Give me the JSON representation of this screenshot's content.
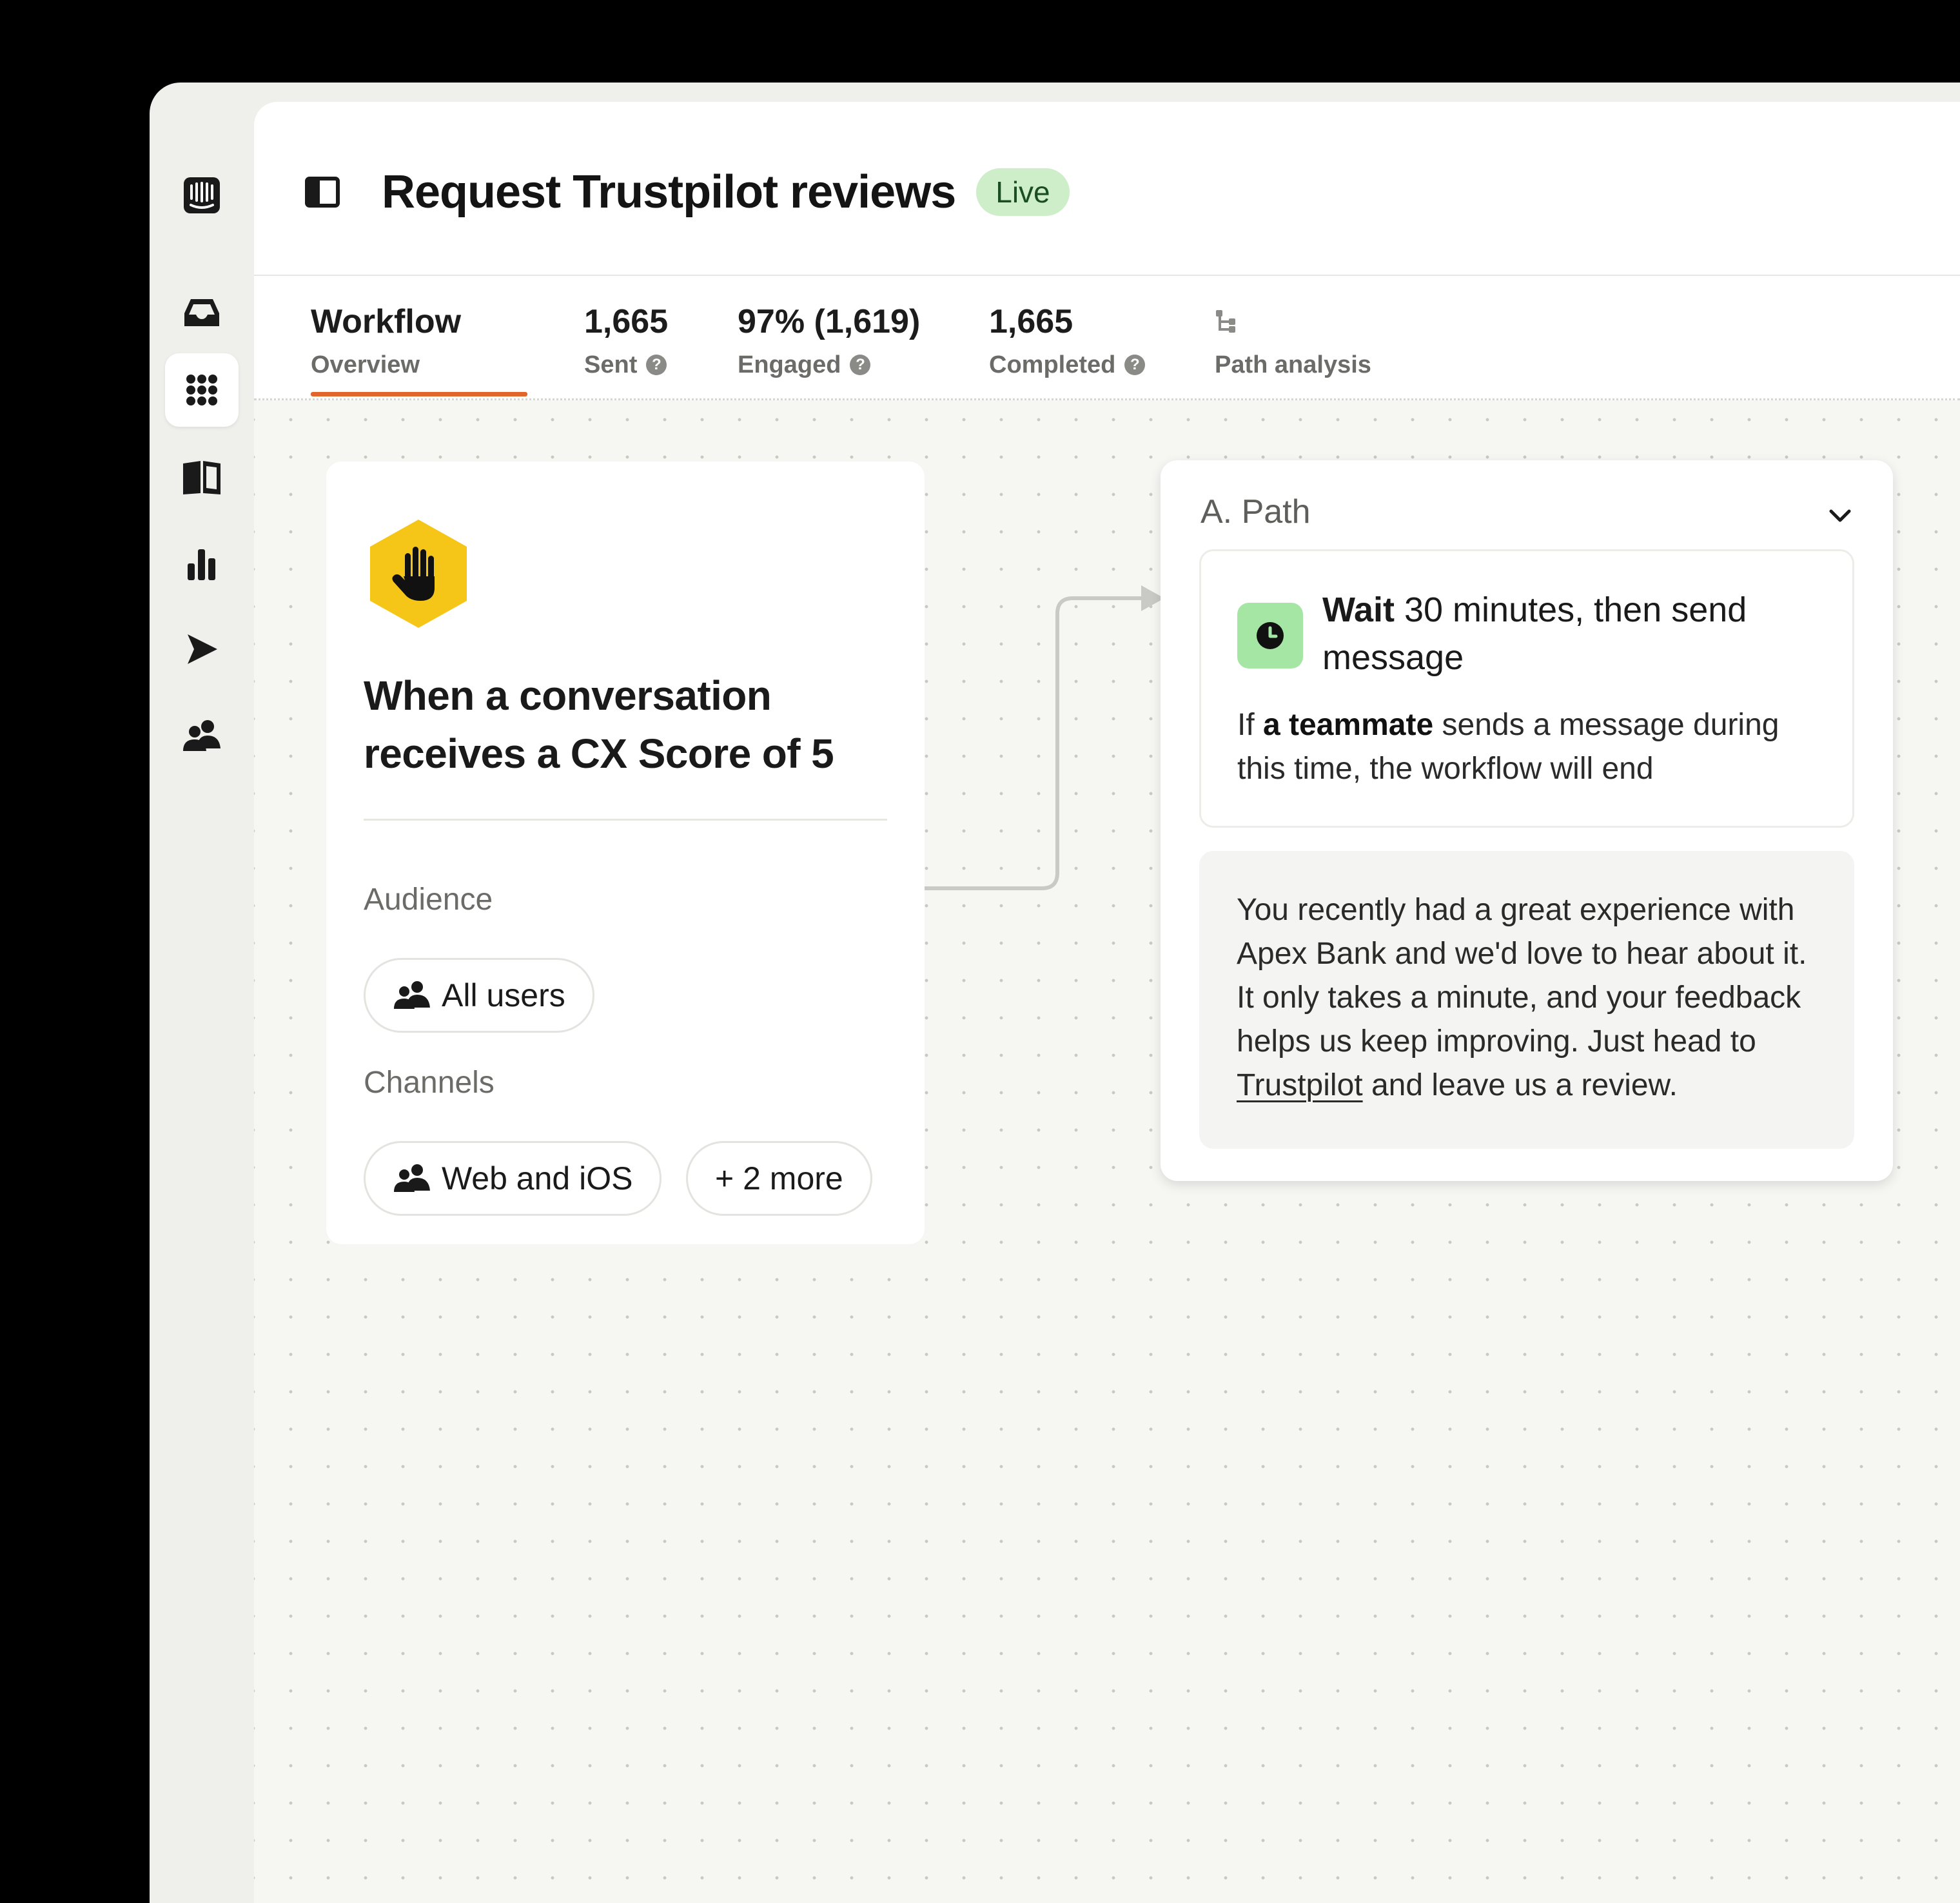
{
  "header": {
    "title": "Request Trustpilot reviews",
    "status": "Live"
  },
  "stats": [
    {
      "value": "Workflow",
      "label": "Overview",
      "help": false
    },
    {
      "value": "1,665",
      "label": "Sent",
      "help": true
    },
    {
      "value": "97% (1,619)",
      "label": "Engaged",
      "help": true
    },
    {
      "value": "1,665",
      "label": "Completed",
      "help": true
    },
    {
      "value": "",
      "label": "Path analysis",
      "help": false
    }
  ],
  "trigger": {
    "title": "When a conversation receives a CX Score of 5",
    "audience_label": "Audience",
    "audience_value": "All users",
    "channels_label": "Channels",
    "channels_value": "Web and iOS",
    "channels_more": "+ 2 more"
  },
  "path": {
    "label": "A. Path",
    "wait_bold": "Wait",
    "wait_rest": " 30 minutes, then send message",
    "note_prefix": "If ",
    "note_bold": "a teammate",
    "note_rest": " sends a message during this time, the workflow will end",
    "message_before": "You recently had a great experience with Apex Bank and we'd love to hear about it. It only takes a minute, and your feedback helps us keep improving. Just head to ",
    "message_link": "Trustpilot",
    "message_after": " and leave us a review."
  },
  "icons": {
    "help_glyph": "?",
    "nav": [
      "intercom-logo-icon",
      "inbox-icon",
      "apps-grid-icon",
      "knowledge-book-icon",
      "reports-chart-icon",
      "outbound-send-icon",
      "contacts-people-icon"
    ]
  },
  "colors": {
    "accent": "#e0662c",
    "live_badge": "#cdeec9",
    "trigger_hex": "#f5c518",
    "clock_badge": "#a5e6a4"
  }
}
